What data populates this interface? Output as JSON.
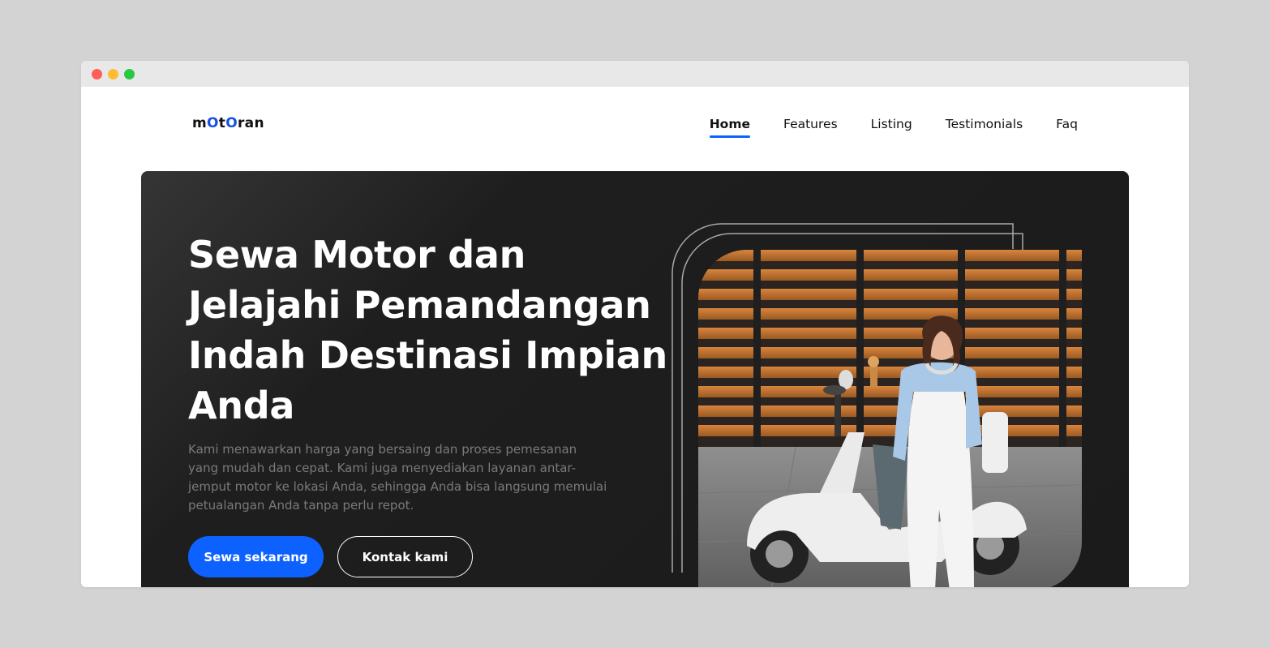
{
  "window": {
    "controls": [
      "close",
      "minimize",
      "maximize"
    ]
  },
  "brand": {
    "logo_parts": [
      "m",
      "O",
      "t",
      "O",
      "ran"
    ],
    "accent": "#1550e8"
  },
  "nav": {
    "items": [
      {
        "label": "Home",
        "active": true
      },
      {
        "label": "Features",
        "active": false
      },
      {
        "label": "Listing",
        "active": false
      },
      {
        "label": "Testimonials",
        "active": false
      },
      {
        "label": "Faq",
        "active": false
      }
    ]
  },
  "hero": {
    "headline": "Sewa Motor dan Jelajahi Pemandangan Indah Destinasi Impian Anda",
    "description": "Kami menawarkan harga yang bersaing dan proses pemesanan yang mudah dan cepat. Kami juga menyediakan layanan antar-jemput motor ke lokasi Anda, sehingga Anda bisa langsung memulai petualangan Anda tanpa perlu repot.",
    "primary_button": "Sewa sekarang",
    "secondary_button": "Kontak kami",
    "image": "woman-with-scooter-photo"
  },
  "colors": {
    "primary": "#0d62ff",
    "hero_bg": "#1e1e1e",
    "page_bg": "#d3d3d3"
  }
}
